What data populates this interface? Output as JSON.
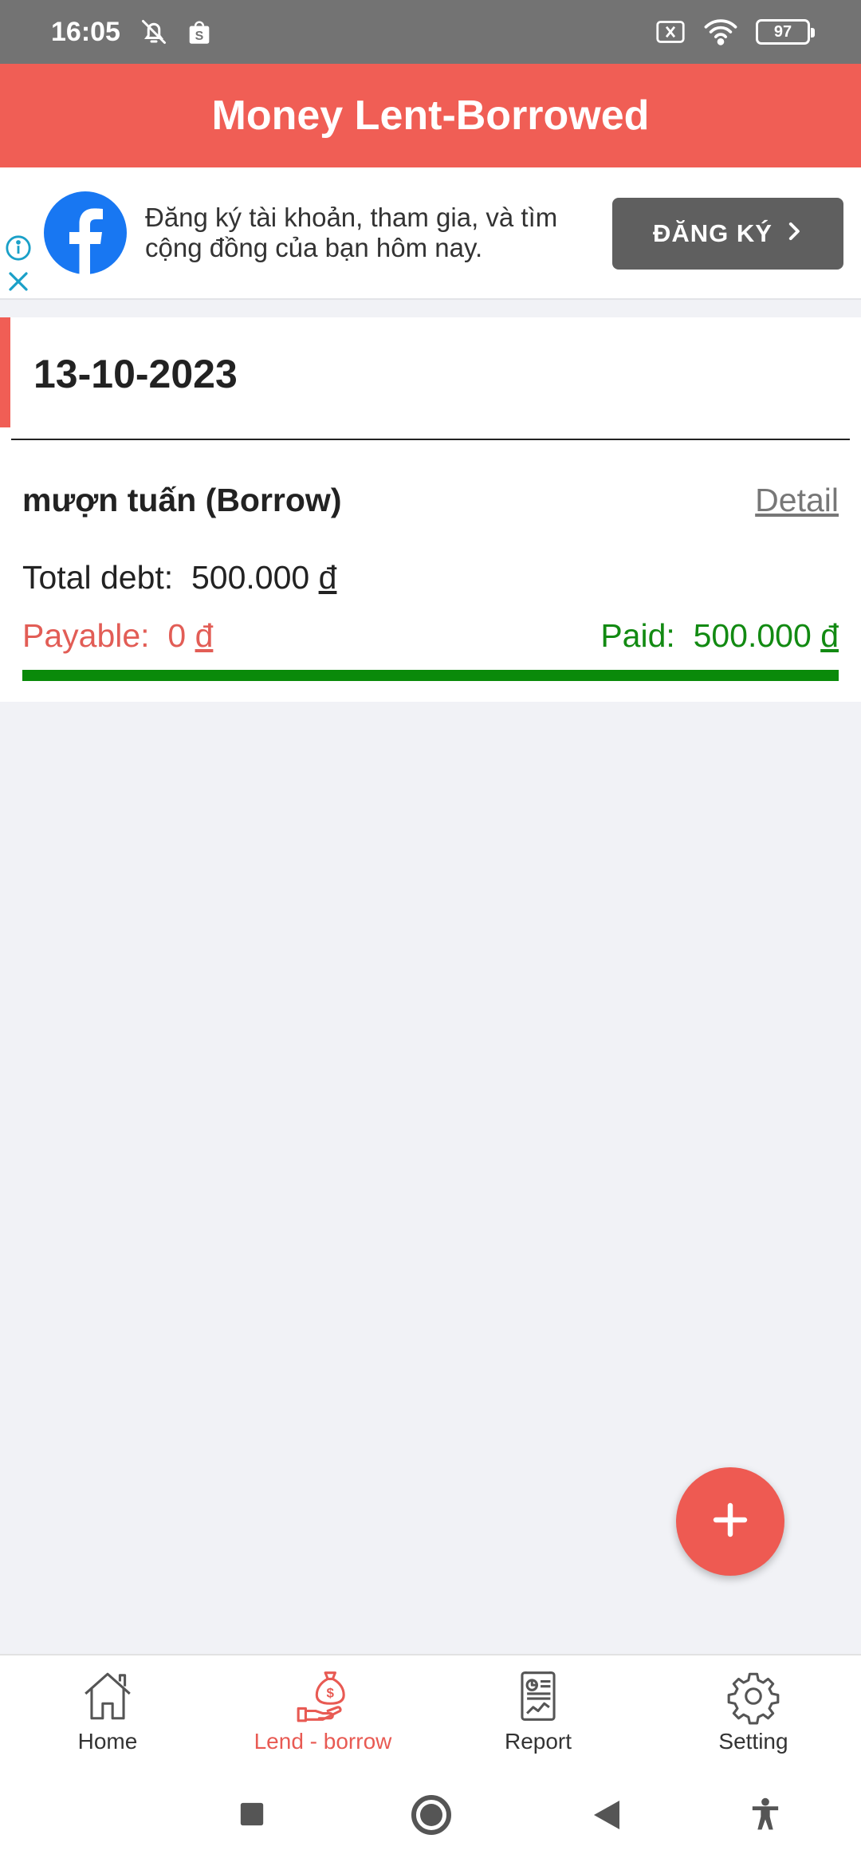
{
  "status_bar": {
    "time": "16:05",
    "battery": "97",
    "icons": [
      "bell-off-icon",
      "shopee-icon",
      "sim-x-icon",
      "wifi-icon",
      "battery-icon"
    ]
  },
  "app_bar": {
    "title": "Money Lent-Borrowed"
  },
  "ad": {
    "text": "Đăng ký tài khoản, tham gia, và tìm cộng đồng của bạn hôm nay.",
    "button_label": "ĐĂNG KÝ",
    "brand_color": "#1877f2"
  },
  "date_group": {
    "date": "13-10-2023"
  },
  "record": {
    "title": "mượn tuấn (Borrow)",
    "detail_label": "Detail",
    "total_label": "Total debt:",
    "total_value": "500.000",
    "payable_label": "Payable:",
    "payable_value": "0",
    "paid_label": "Paid:",
    "paid_value": "500.000",
    "currency": "đ",
    "paid_fraction": 1.0
  },
  "bottom_nav": {
    "items": [
      {
        "label": "Home",
        "icon": "home-icon"
      },
      {
        "label": "Lend - borrow",
        "icon": "money-bag-hand-icon",
        "active": true
      },
      {
        "label": "Report",
        "icon": "report-icon"
      },
      {
        "label": "Setting",
        "icon": "gear-icon"
      }
    ]
  },
  "colors": {
    "accent": "#f05e55",
    "paid": "#128a12",
    "payable": "#e25d56",
    "status_bar": "#737373"
  }
}
